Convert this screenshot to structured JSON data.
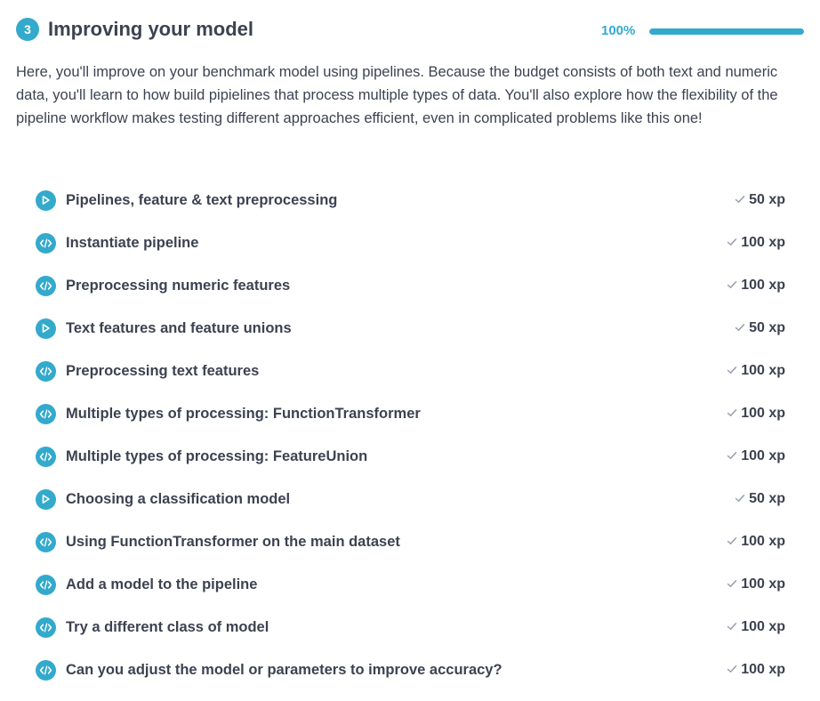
{
  "chapter": {
    "number": "3",
    "title": "Improving your model",
    "progress_label": "100%",
    "progress_value": 1.0,
    "description": "Here, you'll improve on your benchmark model using pipelines. Because the budget consists of both text and numeric data, you'll learn to how build pipielines that process multiple types of data. You'll also explore how the flexibility of the pipeline workflow makes testing different approaches efficient, even in complicated problems like this one!",
    "accent_color": "#33aacc",
    "text_color": "#3d4251"
  },
  "exercises": [
    {
      "type": "video",
      "icon": "play-icon",
      "title": "Pipelines, feature & text preprocessing",
      "xp": "50 xp"
    },
    {
      "type": "code",
      "icon": "code-icon",
      "title": "Instantiate pipeline",
      "xp": "100 xp"
    },
    {
      "type": "code",
      "icon": "code-icon",
      "title": "Preprocessing numeric features",
      "xp": "100 xp"
    },
    {
      "type": "video",
      "icon": "play-icon",
      "title": "Text features and feature unions",
      "xp": "50 xp"
    },
    {
      "type": "code",
      "icon": "code-icon",
      "title": "Preprocessing text features",
      "xp": "100 xp"
    },
    {
      "type": "code",
      "icon": "code-icon",
      "title": "Multiple types of processing: FunctionTransformer",
      "xp": "100 xp"
    },
    {
      "type": "code",
      "icon": "code-icon",
      "title": "Multiple types of processing: FeatureUnion",
      "xp": "100 xp"
    },
    {
      "type": "video",
      "icon": "play-icon",
      "title": "Choosing a classification model",
      "xp": "50 xp"
    },
    {
      "type": "code",
      "icon": "code-icon",
      "title": "Using FunctionTransformer on the main dataset",
      "xp": "100 xp"
    },
    {
      "type": "code",
      "icon": "code-icon",
      "title": "Add a model to the pipeline",
      "xp": "100 xp"
    },
    {
      "type": "code",
      "icon": "code-icon",
      "title": "Try a different class of model",
      "xp": "100 xp"
    },
    {
      "type": "code",
      "icon": "code-icon",
      "title": "Can you adjust the model or parameters to improve accuracy?",
      "xp": "100 xp"
    }
  ]
}
